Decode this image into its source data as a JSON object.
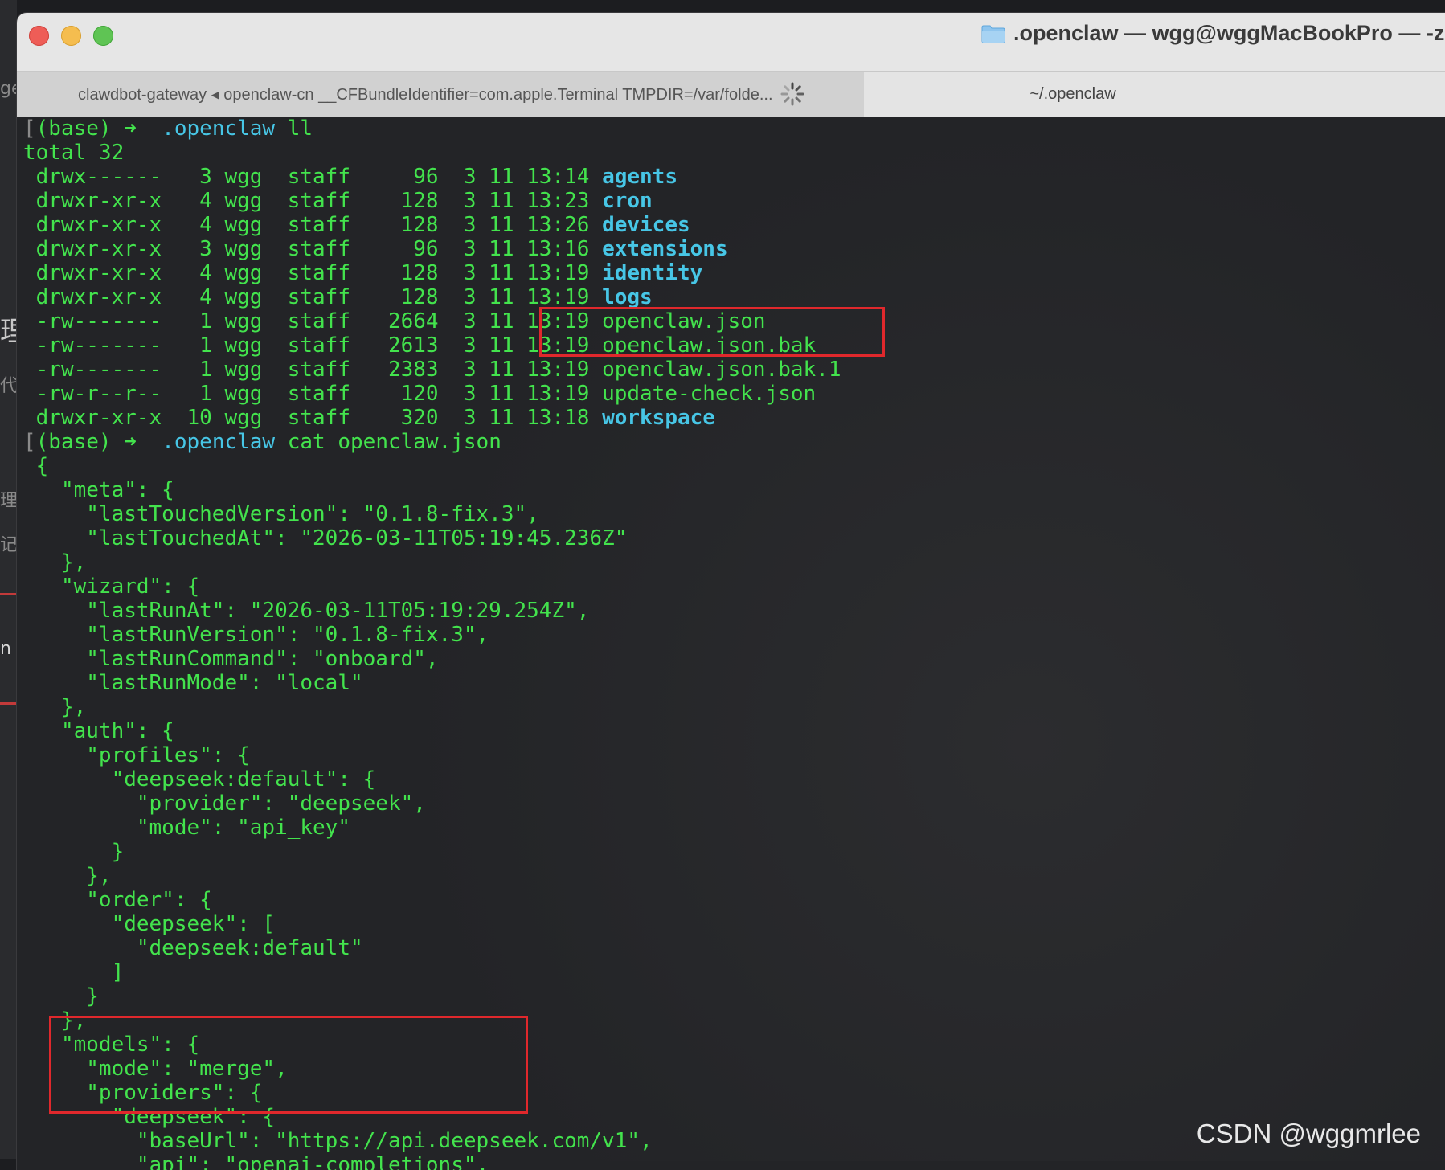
{
  "window": {
    "title": ".openclaw — wgg@wggMacBookPro — -zsh",
    "tabs": [
      {
        "label": "clawdbot-gateway ◂ openclaw-cn __CFBundleIdentifier=com.apple.Terminal TMPDIR=/var/folde...",
        "active": false
      },
      {
        "label": "~/.openclaw",
        "active": true
      }
    ]
  },
  "terminal": {
    "prompt_base": "(base)",
    "prompt_arrow": "➜",
    "prompt_dir": ".openclaw",
    "cmd1": "ll",
    "total": "total 32",
    "listing": [
      {
        "perms": "drwx------",
        "links": " 3",
        "owner": "wgg",
        "group": "staff",
        "size": "  96",
        "date": "3 11 13:14",
        "name": "agents",
        "is_dir": true
      },
      {
        "perms": "drwxr-xr-x",
        "links": " 4",
        "owner": "wgg",
        "group": "staff",
        "size": " 128",
        "date": "3 11 13:23",
        "name": "cron",
        "is_dir": true
      },
      {
        "perms": "drwxr-xr-x",
        "links": " 4",
        "owner": "wgg",
        "group": "staff",
        "size": " 128",
        "date": "3 11 13:26",
        "name": "devices",
        "is_dir": true
      },
      {
        "perms": "drwxr-xr-x",
        "links": " 3",
        "owner": "wgg",
        "group": "staff",
        "size": "  96",
        "date": "3 11 13:16",
        "name": "extensions",
        "is_dir": true
      },
      {
        "perms": "drwxr-xr-x",
        "links": " 4",
        "owner": "wgg",
        "group": "staff",
        "size": " 128",
        "date": "3 11 13:19",
        "name": "identity",
        "is_dir": true
      },
      {
        "perms": "drwxr-xr-x",
        "links": " 4",
        "owner": "wgg",
        "group": "staff",
        "size": " 128",
        "date": "3 11 13:19",
        "name": "logs",
        "is_dir": true
      },
      {
        "perms": "-rw-------",
        "links": " 1",
        "owner": "wgg",
        "group": "staff",
        "size": "2664",
        "date": "3 11 13:19",
        "name": "openclaw.json",
        "is_dir": false
      },
      {
        "perms": "-rw-------",
        "links": " 1",
        "owner": "wgg",
        "group": "staff",
        "size": "2613",
        "date": "3 11 13:19",
        "name": "openclaw.json.bak",
        "is_dir": false
      },
      {
        "perms": "-rw-------",
        "links": " 1",
        "owner": "wgg",
        "group": "staff",
        "size": "2383",
        "date": "3 11 13:19",
        "name": "openclaw.json.bak.1",
        "is_dir": false
      },
      {
        "perms": "-rw-r--r--",
        "links": " 1",
        "owner": "wgg",
        "group": "staff",
        "size": " 120",
        "date": "3 11 13:19",
        "name": "update-check.json",
        "is_dir": false
      },
      {
        "perms": "drwxr-xr-x",
        "links": "10",
        "owner": "wgg",
        "group": "staff",
        "size": " 320",
        "date": "3 11 13:18",
        "name": "workspace",
        "is_dir": true
      }
    ],
    "cmd2": "cat openclaw.json",
    "json_lines": [
      "{",
      "  \"meta\": {",
      "    \"lastTouchedVersion\": \"0.1.8-fix.3\",",
      "    \"lastTouchedAt\": \"2026-03-11T05:19:45.236Z\"",
      "  },",
      "  \"wizard\": {",
      "    \"lastRunAt\": \"2026-03-11T05:19:29.254Z\",",
      "    \"lastRunVersion\": \"0.1.8-fix.3\",",
      "    \"lastRunCommand\": \"onboard\",",
      "    \"lastRunMode\": \"local\"",
      "  },",
      "  \"auth\": {",
      "    \"profiles\": {",
      "      \"deepseek:default\": {",
      "        \"provider\": \"deepseek\",",
      "        \"mode\": \"api_key\"",
      "      }",
      "    },",
      "    \"order\": {",
      "      \"deepseek\": [",
      "        \"deepseek:default\"",
      "      ]",
      "    }",
      "  },",
      "  \"models\": {",
      "    \"mode\": \"merge\",",
      "    \"providers\": {",
      "      \"deepseek\": {",
      "        \"baseUrl\": \"https://api.deepseek.com/v1\",",
      "        \"api\": \"openai-completions\","
    ]
  },
  "watermark": "CSDN @wggmrlee",
  "background_fragments": [
    "ge",
    "理",
    "代",
    "理",
    "记",
    "n"
  ],
  "colors": {
    "terminal_green": "#43e34d",
    "dir_cyan": "#47c6e6",
    "highlight_red": "#e0282c"
  }
}
